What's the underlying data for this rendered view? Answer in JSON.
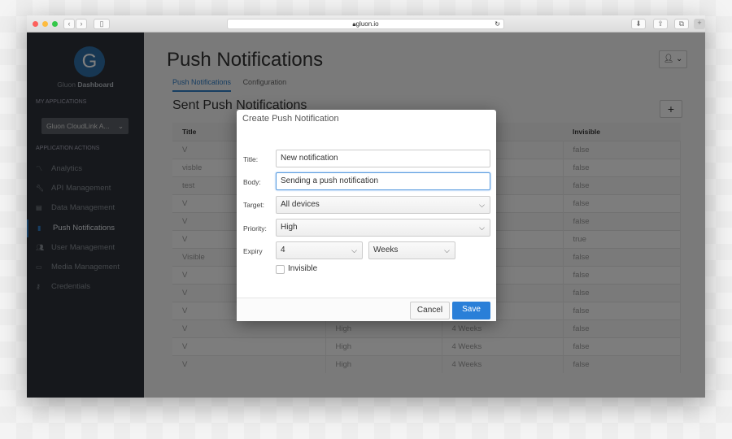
{
  "browser": {
    "url": "gluon.io",
    "traffic_lights": [
      "#fc605c",
      "#fdbc40",
      "#34c84a"
    ]
  },
  "sidebar": {
    "brand_light": "Gluon",
    "brand_bold": "Dashboard",
    "my_apps_label": "MY APPLICATIONS",
    "app_selected": "Gluon CloudLink A...",
    "actions_label": "APPLICATION ACTIONS",
    "items": [
      {
        "label": "Analytics",
        "icon": "chart-icon"
      },
      {
        "label": "API Management",
        "icon": "wrench-icon"
      },
      {
        "label": "Data Management",
        "icon": "database-icon"
      },
      {
        "label": "Push Notifications",
        "icon": "bell-icon",
        "active": true
      },
      {
        "label": "User Management",
        "icon": "users-icon"
      },
      {
        "label": "Media Management",
        "icon": "video-icon"
      },
      {
        "label": "Credentials",
        "icon": "key-icon"
      }
    ]
  },
  "main": {
    "title": "Push Notifications",
    "tabs": [
      "Push Notifications",
      "Configuration"
    ],
    "section_title": "Sent Push Notifications",
    "add_label": "+",
    "table": {
      "headers": [
        "Title",
        "",
        "",
        "Invisible"
      ],
      "rows": [
        [
          "V",
          "",
          "",
          "false"
        ],
        [
          "visble",
          "",
          "",
          "false"
        ],
        [
          "test",
          "",
          "",
          "false"
        ],
        [
          "V",
          "",
          "",
          "false"
        ],
        [
          "V",
          "",
          "",
          "false"
        ],
        [
          "V",
          "",
          "",
          "true"
        ],
        [
          "Visible",
          "",
          "",
          "false"
        ],
        [
          "V",
          "",
          "",
          "false"
        ],
        [
          "V",
          "",
          "",
          "false"
        ],
        [
          "V",
          "",
          "",
          "false"
        ],
        [
          "V",
          "High",
          "4 Weeks",
          "false"
        ],
        [
          "V",
          "High",
          "4 Weeks",
          "false"
        ],
        [
          "V",
          "High",
          "4 Weeks",
          "false"
        ]
      ]
    }
  },
  "modal": {
    "title": "Create Push Notification",
    "title_label": "Title:",
    "title_value": "New notification",
    "body_label": "Body:",
    "body_value": "Sending a push notification",
    "target_label": "Target:",
    "target_value": "All devices",
    "priority_label": "Priority:",
    "priority_value": "High",
    "expiry_label": "Expiry",
    "expiry_amount": "4",
    "expiry_unit": "Weeks",
    "invisible_label": "Invisible",
    "invisible_checked": false,
    "cancel": "Cancel",
    "save": "Save",
    "accent": "#2a7fd8"
  }
}
